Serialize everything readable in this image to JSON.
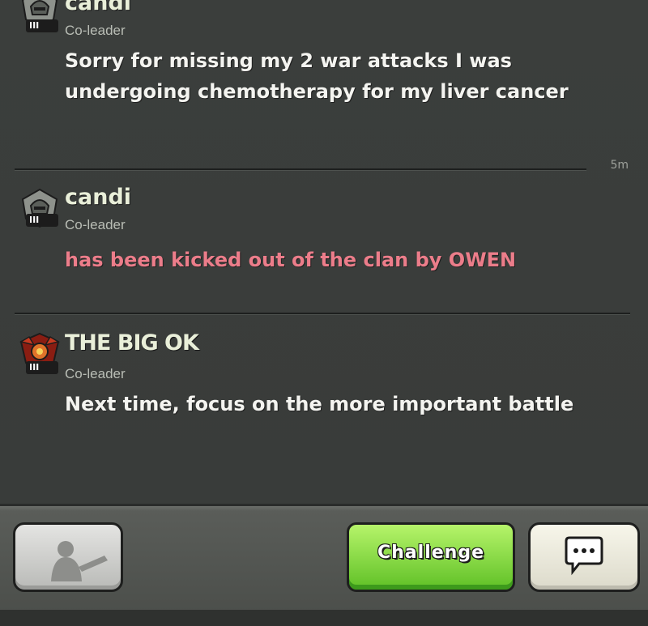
{
  "messages": [
    {
      "name": "candi",
      "role": "Co-leader",
      "badge": "III",
      "text": "Sorry for missing my 2 war attacks I was undergoing chemotherapy for my liver cancer"
    },
    {
      "name": "candi",
      "role": "Co-leader",
      "badge": "III",
      "text": "has been kicked out of the clan by OWEN",
      "time": "5m"
    },
    {
      "name": "THE BIG OK",
      "role": "Co-leader",
      "badge": "III",
      "text": "Next time, focus on the more important battle"
    }
  ],
  "bottom_bar": {
    "challenge_label": "Challenge",
    "troop_icon": "barbarian-silhouette-icon",
    "chat_icon": "chat-bubble-icon"
  },
  "colors": {
    "kicked_text": "#ec7d8a",
    "challenge_green": "#5fc026"
  }
}
